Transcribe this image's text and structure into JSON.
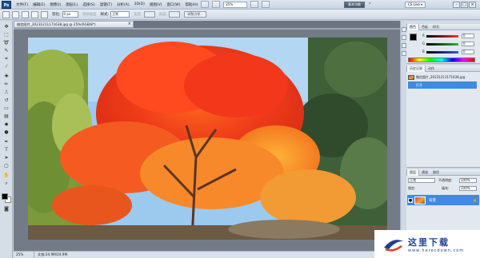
{
  "app": {
    "logo": "Ps"
  },
  "menu": [
    "文件(F)",
    "编辑(E)",
    "图像(I)",
    "图层(L)",
    "选择(S)",
    "滤镜(T)",
    "分析(A)",
    "3D(D)",
    "视图(V)",
    "窗口(W)",
    "帮助(H)"
  ],
  "menubar": {
    "zoom": "25%",
    "workspace_active": "基本功能",
    "workspace_more": "»",
    "cs_live": "CS Live ▾",
    "min": "–",
    "max": "□",
    "close": "×"
  },
  "options": {
    "feather_label": "羽化:",
    "feather_value": "0 px",
    "antialias_label": "消除锯齿",
    "style_label": "样式:",
    "style_value": "正常",
    "width_label": "宽度:",
    "height_label": "高度:",
    "refine_button": "调整边缘..."
  },
  "document": {
    "tab_title": "微信图片_20231211171638.jpg @ 25%(RGB/8*)",
    "tab_close": "×",
    "status_zoom": "25%",
    "status_doc": "文档:24.9M/24.9M"
  },
  "panels": {
    "color_tab": "颜色",
    "swatches_tab": "色板",
    "styles_tab": "样式",
    "sliders": [
      {
        "label": "R",
        "value": "0",
        "color": "#e23b3b"
      },
      {
        "label": "G",
        "value": "0",
        "color": "#36b13a"
      },
      {
        "label": "B",
        "value": "0",
        "color": "#3a55d8"
      }
    ],
    "history_tab": "历史记录",
    "actions_tab": "动作",
    "history_items": [
      "微信图片_20231211171638.jpg",
      "打开"
    ],
    "layers_tab": "图层",
    "channels_tab": "通道",
    "paths_tab": "路径",
    "blend_mode": "正常",
    "opacity_label": "不透明度:",
    "opacity_value": "100%",
    "lock_label": "锁定:",
    "fill_label": "填充:",
    "fill_value": "100%",
    "layer_name": "背景",
    "lock_glyph": "🔒"
  },
  "watermark": {
    "title": "这里下载",
    "url": "www.herecdown.com"
  },
  "colors": {
    "accent": "#3d8be2",
    "brand": "#1c4f93"
  }
}
